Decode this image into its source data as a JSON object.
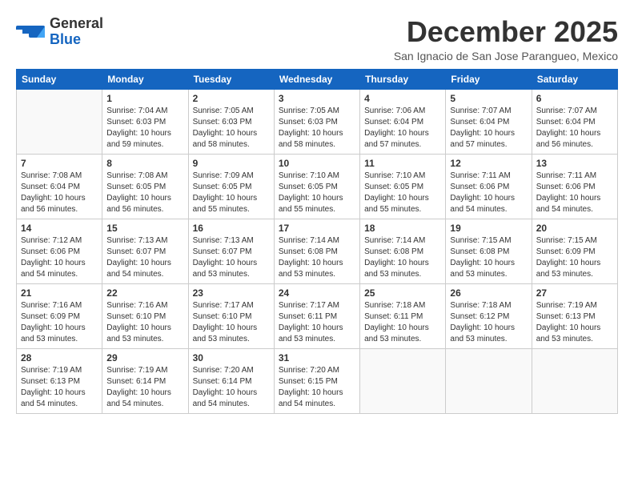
{
  "header": {
    "logo_general": "General",
    "logo_blue": "Blue",
    "month_title": "December 2025",
    "subtitle": "San Ignacio de San Jose Parangueo, Mexico"
  },
  "days_of_week": [
    "Sunday",
    "Monday",
    "Tuesday",
    "Wednesday",
    "Thursday",
    "Friday",
    "Saturday"
  ],
  "weeks": [
    [
      {
        "day": "",
        "sunrise": "",
        "sunset": "",
        "daylight": ""
      },
      {
        "day": "1",
        "sunrise": "Sunrise: 7:04 AM",
        "sunset": "Sunset: 6:03 PM",
        "daylight": "Daylight: 10 hours and 59 minutes."
      },
      {
        "day": "2",
        "sunrise": "Sunrise: 7:05 AM",
        "sunset": "Sunset: 6:03 PM",
        "daylight": "Daylight: 10 hours and 58 minutes."
      },
      {
        "day": "3",
        "sunrise": "Sunrise: 7:05 AM",
        "sunset": "Sunset: 6:03 PM",
        "daylight": "Daylight: 10 hours and 58 minutes."
      },
      {
        "day": "4",
        "sunrise": "Sunrise: 7:06 AM",
        "sunset": "Sunset: 6:04 PM",
        "daylight": "Daylight: 10 hours and 57 minutes."
      },
      {
        "day": "5",
        "sunrise": "Sunrise: 7:07 AM",
        "sunset": "Sunset: 6:04 PM",
        "daylight": "Daylight: 10 hours and 57 minutes."
      },
      {
        "day": "6",
        "sunrise": "Sunrise: 7:07 AM",
        "sunset": "Sunset: 6:04 PM",
        "daylight": "Daylight: 10 hours and 56 minutes."
      }
    ],
    [
      {
        "day": "7",
        "sunrise": "Sunrise: 7:08 AM",
        "sunset": "Sunset: 6:04 PM",
        "daylight": "Daylight: 10 hours and 56 minutes."
      },
      {
        "day": "8",
        "sunrise": "Sunrise: 7:08 AM",
        "sunset": "Sunset: 6:05 PM",
        "daylight": "Daylight: 10 hours and 56 minutes."
      },
      {
        "day": "9",
        "sunrise": "Sunrise: 7:09 AM",
        "sunset": "Sunset: 6:05 PM",
        "daylight": "Daylight: 10 hours and 55 minutes."
      },
      {
        "day": "10",
        "sunrise": "Sunrise: 7:10 AM",
        "sunset": "Sunset: 6:05 PM",
        "daylight": "Daylight: 10 hours and 55 minutes."
      },
      {
        "day": "11",
        "sunrise": "Sunrise: 7:10 AM",
        "sunset": "Sunset: 6:05 PM",
        "daylight": "Daylight: 10 hours and 55 minutes."
      },
      {
        "day": "12",
        "sunrise": "Sunrise: 7:11 AM",
        "sunset": "Sunset: 6:06 PM",
        "daylight": "Daylight: 10 hours and 54 minutes."
      },
      {
        "day": "13",
        "sunrise": "Sunrise: 7:11 AM",
        "sunset": "Sunset: 6:06 PM",
        "daylight": "Daylight: 10 hours and 54 minutes."
      }
    ],
    [
      {
        "day": "14",
        "sunrise": "Sunrise: 7:12 AM",
        "sunset": "Sunset: 6:06 PM",
        "daylight": "Daylight: 10 hours and 54 minutes."
      },
      {
        "day": "15",
        "sunrise": "Sunrise: 7:13 AM",
        "sunset": "Sunset: 6:07 PM",
        "daylight": "Daylight: 10 hours and 54 minutes."
      },
      {
        "day": "16",
        "sunrise": "Sunrise: 7:13 AM",
        "sunset": "Sunset: 6:07 PM",
        "daylight": "Daylight: 10 hours and 53 minutes."
      },
      {
        "day": "17",
        "sunrise": "Sunrise: 7:14 AM",
        "sunset": "Sunset: 6:08 PM",
        "daylight": "Daylight: 10 hours and 53 minutes."
      },
      {
        "day": "18",
        "sunrise": "Sunrise: 7:14 AM",
        "sunset": "Sunset: 6:08 PM",
        "daylight": "Daylight: 10 hours and 53 minutes."
      },
      {
        "day": "19",
        "sunrise": "Sunrise: 7:15 AM",
        "sunset": "Sunset: 6:08 PM",
        "daylight": "Daylight: 10 hours and 53 minutes."
      },
      {
        "day": "20",
        "sunrise": "Sunrise: 7:15 AM",
        "sunset": "Sunset: 6:09 PM",
        "daylight": "Daylight: 10 hours and 53 minutes."
      }
    ],
    [
      {
        "day": "21",
        "sunrise": "Sunrise: 7:16 AM",
        "sunset": "Sunset: 6:09 PM",
        "daylight": "Daylight: 10 hours and 53 minutes."
      },
      {
        "day": "22",
        "sunrise": "Sunrise: 7:16 AM",
        "sunset": "Sunset: 6:10 PM",
        "daylight": "Daylight: 10 hours and 53 minutes."
      },
      {
        "day": "23",
        "sunrise": "Sunrise: 7:17 AM",
        "sunset": "Sunset: 6:10 PM",
        "daylight": "Daylight: 10 hours and 53 minutes."
      },
      {
        "day": "24",
        "sunrise": "Sunrise: 7:17 AM",
        "sunset": "Sunset: 6:11 PM",
        "daylight": "Daylight: 10 hours and 53 minutes."
      },
      {
        "day": "25",
        "sunrise": "Sunrise: 7:18 AM",
        "sunset": "Sunset: 6:11 PM",
        "daylight": "Daylight: 10 hours and 53 minutes."
      },
      {
        "day": "26",
        "sunrise": "Sunrise: 7:18 AM",
        "sunset": "Sunset: 6:12 PM",
        "daylight": "Daylight: 10 hours and 53 minutes."
      },
      {
        "day": "27",
        "sunrise": "Sunrise: 7:19 AM",
        "sunset": "Sunset: 6:13 PM",
        "daylight": "Daylight: 10 hours and 53 minutes."
      }
    ],
    [
      {
        "day": "28",
        "sunrise": "Sunrise: 7:19 AM",
        "sunset": "Sunset: 6:13 PM",
        "daylight": "Daylight: 10 hours and 54 minutes."
      },
      {
        "day": "29",
        "sunrise": "Sunrise: 7:19 AM",
        "sunset": "Sunset: 6:14 PM",
        "daylight": "Daylight: 10 hours and 54 minutes."
      },
      {
        "day": "30",
        "sunrise": "Sunrise: 7:20 AM",
        "sunset": "Sunset: 6:14 PM",
        "daylight": "Daylight: 10 hours and 54 minutes."
      },
      {
        "day": "31",
        "sunrise": "Sunrise: 7:20 AM",
        "sunset": "Sunset: 6:15 PM",
        "daylight": "Daylight: 10 hours and 54 minutes."
      },
      {
        "day": "",
        "sunrise": "",
        "sunset": "",
        "daylight": ""
      },
      {
        "day": "",
        "sunrise": "",
        "sunset": "",
        "daylight": ""
      },
      {
        "day": "",
        "sunrise": "",
        "sunset": "",
        "daylight": ""
      }
    ]
  ]
}
